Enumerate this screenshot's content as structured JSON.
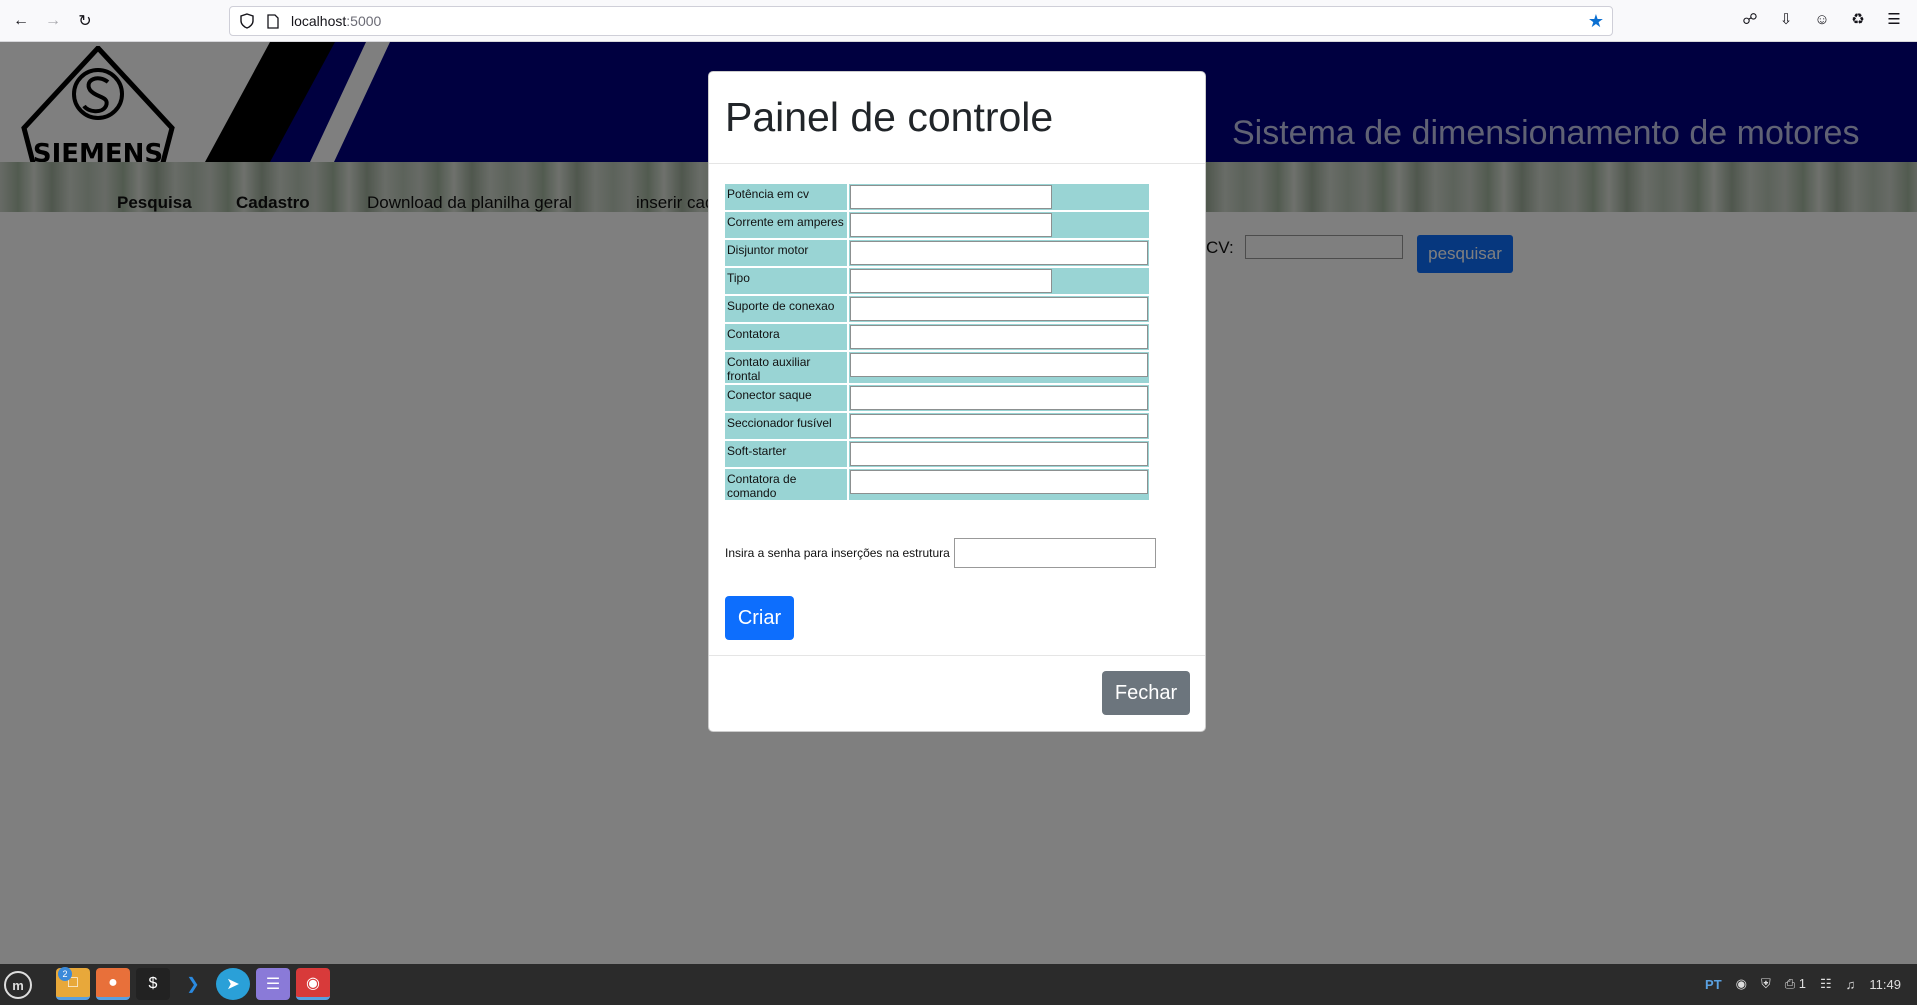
{
  "browser": {
    "url_host": "localhost",
    "url_port": ":5000"
  },
  "header": {
    "logo_text": "SIEMENS",
    "title": "Sistema de dimensionamento de motores"
  },
  "menu": {
    "items": [
      {
        "label": "Pesquisa"
      },
      {
        "label": "Cadastro"
      },
      {
        "label": "Download da planilha geral"
      },
      {
        "label": "inserir cad"
      }
    ]
  },
  "search": {
    "label": "CV:",
    "button": "pesquisar"
  },
  "modal": {
    "title": "Painel de controle",
    "fields": [
      {
        "label": "Potência em cv"
      },
      {
        "label": "Corrente em amperes"
      },
      {
        "label": "Disjuntor motor"
      },
      {
        "label": "Tipo"
      },
      {
        "label": "Suporte de conexao"
      },
      {
        "label": "Contatora"
      },
      {
        "label": "Contato auxiliar frontal"
      },
      {
        "label": "Conector saque"
      },
      {
        "label": "Seccionador fusível"
      },
      {
        "label": "Soft-starter"
      },
      {
        "label": "Contatora de comando"
      }
    ],
    "password_label": "Insira a senha para inserções na estrutura",
    "submit_button": "Criar",
    "close_button": "Fechar"
  },
  "taskbar": {
    "badge_count": "2",
    "language": "PT",
    "printer_count": "1",
    "clock": "11:49"
  }
}
